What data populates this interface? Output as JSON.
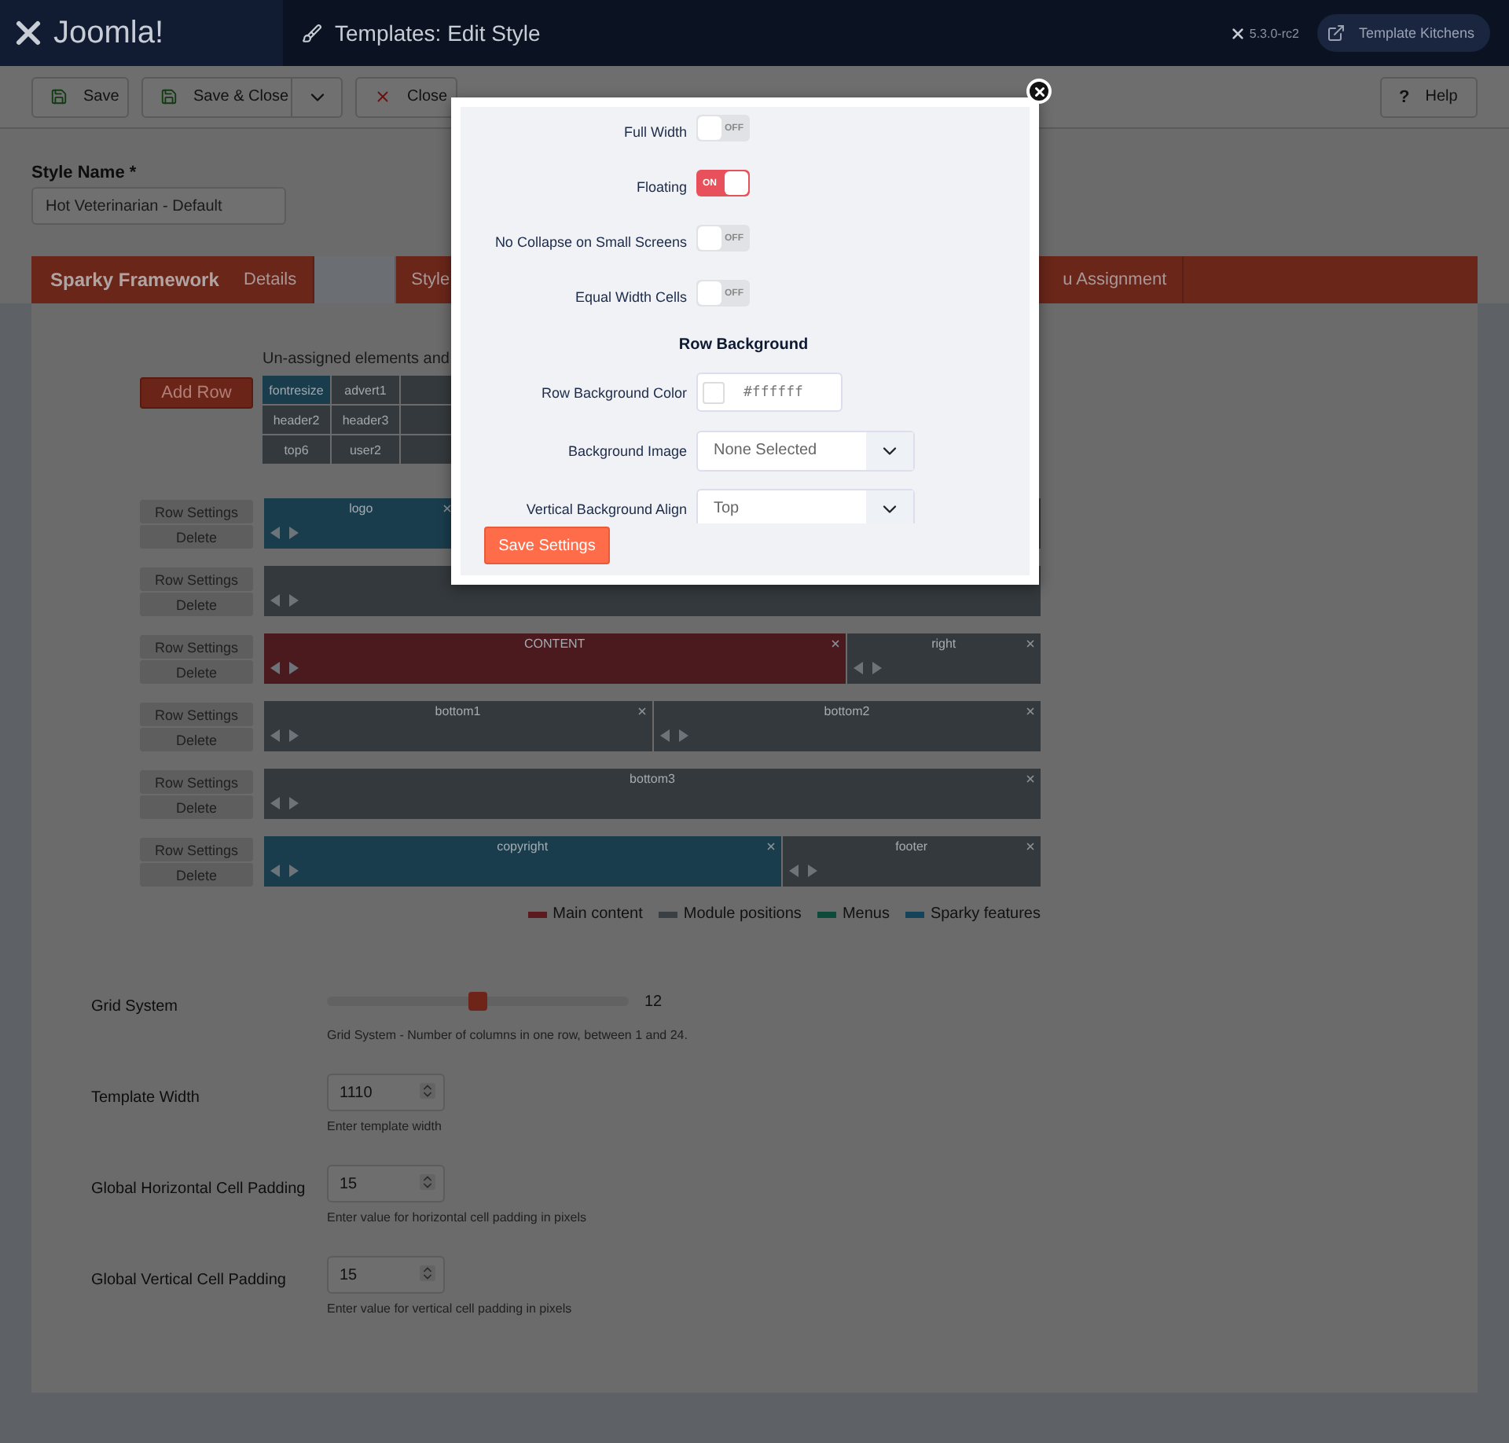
{
  "header": {
    "logo": "Joomla!",
    "title": "Templates: Edit Style",
    "version": "5.3.0-rc2",
    "site_button": "Template Kitchens"
  },
  "toolbar": {
    "buttons": [
      {
        "label": "Save",
        "kind": "save"
      },
      {
        "label": "Save & Close",
        "kind": "save-close"
      },
      {
        "label": "Close",
        "kind": "close"
      }
    ],
    "help_icon": "?",
    "help": "Help"
  },
  "style_name": {
    "label": "Style Name *",
    "value": "Hot Veterinarian - Default"
  },
  "tabs": {
    "brand": "Sparky Framework",
    "items": [
      {
        "label": "Details",
        "selected": false
      },
      {
        "selected": true
      },
      {
        "label": "Style",
        "selected": false
      },
      {
        "label": "u Assignment",
        "selected": false
      }
    ]
  },
  "layout_builder": {
    "add_row": "Add Row",
    "unassigned_title": "Un-assigned elements and",
    "unassigned": [
      {
        "label": "fontresize",
        "kind": "sparky"
      },
      {
        "label": "advert1",
        "kind": "module"
      },
      {
        "kind": "module"
      },
      {
        "label": "header2",
        "kind": "module"
      },
      {
        "label": "header3",
        "kind": "module"
      },
      {
        "kind": "module"
      },
      {
        "label": "top6",
        "kind": "module"
      },
      {
        "label": "user2",
        "kind": "module"
      },
      {
        "kind": "module"
      }
    ],
    "rows": [
      {
        "settings": "Row Settings",
        "delete": "Delete",
        "cells": [
          {
            "label": "logo",
            "kind": "sparky"
          },
          {
            "kind": "module"
          }
        ]
      },
      {
        "settings": "Row Settings",
        "delete": "Delete",
        "cells": [
          {
            "kind": "module"
          }
        ]
      },
      {
        "settings": "Row Settings",
        "delete": "Delete",
        "cells": [
          {
            "label": "CONTENT",
            "kind": "content"
          },
          {
            "label": "right",
            "kind": "module"
          }
        ]
      },
      {
        "settings": "Row Settings",
        "delete": "Delete",
        "cells": [
          {
            "label": "bottom1",
            "kind": "module"
          },
          {
            "label": "bottom2",
            "kind": "module"
          }
        ]
      },
      {
        "settings": "Row Settings",
        "delete": "Delete",
        "cells": [
          {
            "label": "bottom3",
            "kind": "module"
          }
        ]
      },
      {
        "settings": "Row Settings",
        "delete": "Delete",
        "cells": [
          {
            "label": "copyright",
            "kind": "sparky"
          },
          {
            "label": "footer",
            "kind": "module"
          }
        ]
      }
    ],
    "legend": [
      {
        "label": "Main content",
        "color": "#5a1a1e"
      },
      {
        "label": "Module positions",
        "color": "#3a3f44"
      },
      {
        "label": "Menus",
        "color": "#0e4a3a"
      },
      {
        "label": "Sparky features",
        "color": "#15445a"
      }
    ]
  },
  "settings": [
    {
      "kind": "slider",
      "label": "Grid System",
      "level": 0.5,
      "reading": "12",
      "help": "Grid System - Number of columns in one row, between 1 and 24."
    },
    {
      "kind": "number",
      "label": "Template Width",
      "value": "1110",
      "help": "Enter template width"
    },
    {
      "kind": "number",
      "label": "Global Horizontal Cell Padding",
      "value": "15",
      "help": "Enter value for horizontal cell padding in pixels"
    },
    {
      "kind": "number",
      "label": "Global Vertical Cell Padding",
      "value": "15",
      "help": "Enter value for vertical cell padding in pixels"
    }
  ],
  "modal": {
    "toggles": [
      {
        "label": "Full Width",
        "on": false,
        "state_label": "OFF"
      },
      {
        "label": "Floating",
        "on": true,
        "state_label": "ON"
      },
      {
        "label": "No Collapse on Small Screens",
        "on": false,
        "state_label": "OFF"
      },
      {
        "label": "Equal Width Cells",
        "on": false,
        "state_label": "OFF"
      }
    ],
    "section_title": "Row Background",
    "fields": [
      {
        "kind": "color",
        "label": "Row Background Color",
        "value": "#ffffff"
      },
      {
        "kind": "select",
        "label": "Background Image",
        "value": "None Selected"
      },
      {
        "kind": "select",
        "label": "Vertical Background Align",
        "value": "Top"
      }
    ],
    "save": "Save Settings"
  }
}
